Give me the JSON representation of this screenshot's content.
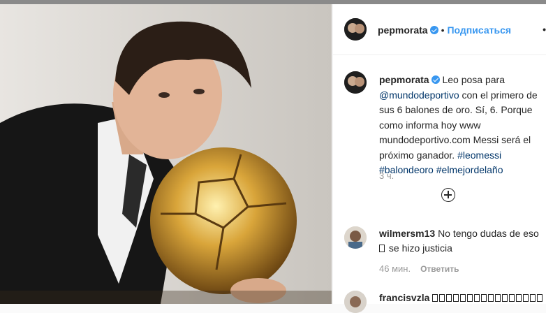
{
  "post": {
    "author": "pepmorata",
    "follow_label": "Подписаться",
    "separator": "•",
    "more_label": "•",
    "caption_author": "pepmorata",
    "caption_part1": "Leo posa para ",
    "caption_mention": "@mundodeportivo",
    "caption_part2": " con el primero de sus 6 balones de oro. Sí, 6. Porque como informa hoy www mundodeportivo.com Messi será el próximo ganador. ",
    "hashtag1": "#leomessi",
    "hashtag2": "#balondeoro",
    "hashtag3": "#elmejordelaño",
    "time": "3 ч."
  },
  "comments": [
    {
      "user": "wilmersm13",
      "text": "No tengo dudas de eso",
      "text2": "se hizo justicia",
      "time": "46 мин.",
      "reply": "Ответить"
    },
    {
      "user": "francisvzla",
      "text": "",
      "time": "",
      "reply": ""
    }
  ],
  "colors": {
    "accent": "#3897f0",
    "link": "#003569",
    "muted": "#999999"
  },
  "icons": {
    "verified": "verified-badge-icon",
    "add": "add-comment-icon",
    "more": "more-options-icon"
  }
}
